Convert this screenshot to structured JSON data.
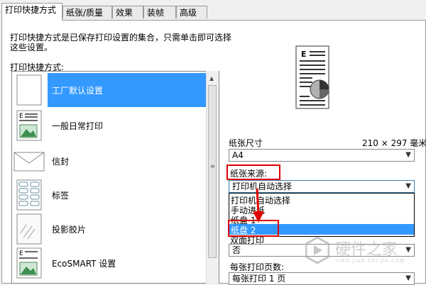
{
  "tabs": [
    {
      "label": "打印快捷方式"
    },
    {
      "label": "纸张/质量"
    },
    {
      "label": "效果"
    },
    {
      "label": "装帧"
    },
    {
      "label": "高级"
    }
  ],
  "description": "打印快捷方式是已保存打印设置的集合，只需单击即可选择这些设置。",
  "description_line1": "打印快捷方式是已保存打印设置的集合，只需单击即可选择",
  "description_line2": "这些设置。",
  "presets_heading": "打印快捷方式:",
  "presets": [
    {
      "label": "工厂默认设置",
      "icon": "blank-page-icon",
      "selected": true
    },
    {
      "label": "一般日常打印",
      "icon": "document-page-icon",
      "selected": false
    },
    {
      "label": "信封",
      "icon": "envelope-icon",
      "selected": false
    },
    {
      "label": "标签",
      "icon": "labels-sheet-icon",
      "selected": false
    },
    {
      "label": "投影胶片",
      "icon": "transparency-icon",
      "selected": false
    },
    {
      "label": "EcoSMART 设置",
      "icon": "eco-document-icon",
      "selected": false
    }
  ],
  "preview": {
    "icon": "page-preview-icon",
    "letter": "E"
  },
  "paper_size": {
    "label": "纸张尺寸",
    "dimensions": "210 × 297 毫米",
    "value": "A4"
  },
  "paper_source": {
    "label": "纸张来源:",
    "value": "打印机自动选择",
    "options": [
      {
        "label": "打印机自动选择"
      },
      {
        "label": "手动进纸"
      },
      {
        "label": "纸盘 1"
      },
      {
        "label": "纸盘 2",
        "highlighted": true
      }
    ]
  },
  "duplex": {
    "label": "双面打印",
    "value": "否"
  },
  "pages_per_sheet": {
    "label": "每张打印页数:",
    "value": "每张打印 1 页"
  },
  "watermark": {
    "line1": "硬件之家",
    "line2": "YING JIAN ZHI JIA.COM"
  },
  "colors": {
    "selection": "#3399ff",
    "annotation": "#e00000"
  }
}
